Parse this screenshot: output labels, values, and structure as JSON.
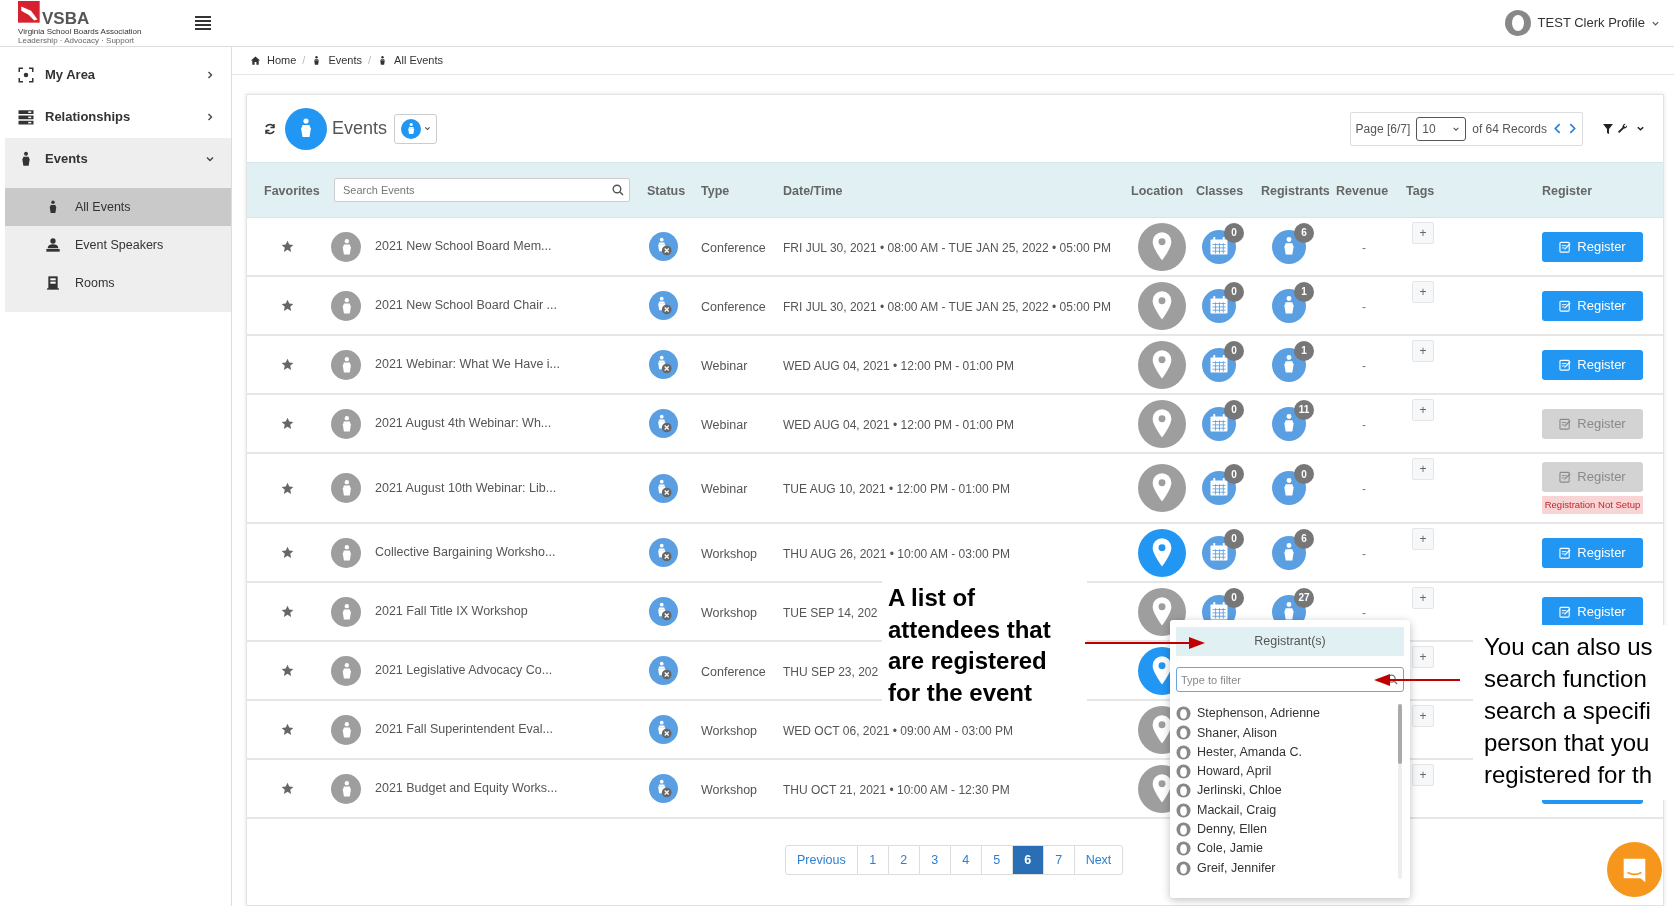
{
  "header": {
    "logo_text": "VSBA",
    "logo_subtitle": "Virginia School Boards Association",
    "logo_tagline": "Leadership · Advocacy · Support",
    "profile": "TEST Clerk Profile"
  },
  "sidebar": [
    {
      "label": "My Area",
      "expanded": false
    },
    {
      "label": "Relationships",
      "expanded": false
    },
    {
      "label": "Events",
      "expanded": true,
      "children": [
        {
          "label": "All Events",
          "selected": true
        },
        {
          "label": "Event Speakers",
          "selected": false
        },
        {
          "label": "Rooms",
          "selected": false
        }
      ]
    }
  ],
  "breadcrumb": [
    {
      "label": "Home"
    },
    {
      "separator": "/",
      "label": "Events"
    },
    {
      "separator": "/",
      "label": "All Events"
    }
  ],
  "card": {
    "title": "Events",
    "page": "Page [6/7]",
    "page_size": "10",
    "records": "of 64 Records"
  },
  "columns": [
    {
      "kind": "text",
      "label": "Favorites"
    },
    {
      "kind": "search",
      "placeholder": "Search Events"
    },
    {
      "kind": "text",
      "label": "Status"
    },
    {
      "kind": "text",
      "label": "Type"
    },
    {
      "kind": "text",
      "label": "Date/Time"
    },
    {
      "kind": "text",
      "label": "Location"
    },
    {
      "kind": "text",
      "label": "Classes"
    },
    {
      "kind": "text",
      "label": "Registrants"
    },
    {
      "kind": "text",
      "label": "Revenue"
    },
    {
      "kind": "text",
      "label": "Tags"
    },
    {
      "kind": "text",
      "label": "Register"
    }
  ],
  "rows": [
    {
      "name": "2021 New School Board Mem...",
      "type": "Conference",
      "datetime": "FRI JUL 30, 2021 • 08:00 AM - TUE JAN 25, 2022 • 05:00 PM",
      "location_set": false,
      "classes": "0",
      "registrants": "6",
      "revenue": "-",
      "tags": "+",
      "register": {
        "label": "Register",
        "disabled": false
      }
    },
    {
      "name": "2021 New School Board Chair ...",
      "type": "Conference",
      "datetime": "FRI JUL 30, 2021 • 08:00 AM - TUE JAN 25, 2022 • 05:00 PM",
      "location_set": false,
      "classes": "0",
      "registrants": "1",
      "revenue": "-",
      "tags": "+",
      "register": {
        "label": "Register",
        "disabled": false
      }
    },
    {
      "name": "2021 Webinar: What We Have i...",
      "type": "Webinar",
      "datetime": "WED AUG 04, 2021 • 12:00 PM - 01:00 PM",
      "location_set": false,
      "classes": "0",
      "registrants": "1",
      "revenue": "-",
      "tags": "+",
      "register": {
        "label": "Register",
        "disabled": false
      }
    },
    {
      "name": "2021 August 4th Webinar: Wh...",
      "type": "Webinar",
      "datetime": "WED AUG 04, 2021 • 12:00 PM - 01:00 PM",
      "location_set": false,
      "classes": "0",
      "registrants": "11",
      "revenue": "-",
      "tags": "+",
      "register": {
        "label": "Register",
        "disabled": true
      }
    },
    {
      "name": "2021 August 10th Webinar: Lib...",
      "type": "Webinar",
      "datetime": "TUE AUG 10, 2021 • 12:00 PM - 01:00 PM",
      "location_set": false,
      "classes": "0",
      "registrants": "0",
      "revenue": "-",
      "tags": "+",
      "register": {
        "label": "Register",
        "disabled": true,
        "note": "Registration Not Setup"
      }
    },
    {
      "name": "Collective Bargaining Worksho...",
      "type": "Workshop",
      "datetime": "THU AUG 26, 2021 • 10:00 AM - 03:00 PM",
      "location_set": true,
      "classes": "0",
      "registrants": "6",
      "revenue": "-",
      "tags": "+",
      "register": {
        "label": "Register",
        "disabled": false
      }
    },
    {
      "name": "2021 Fall Title IX Workshop",
      "type": "Workshop",
      "datetime": "TUE SEP 14, 202",
      "location_set": false,
      "classes": "0",
      "registrants": "27",
      "revenue": "-",
      "tags": "+",
      "register": {
        "label": "Register",
        "disabled": false
      }
    },
    {
      "name": "2021 Legislative Advocacy Co...",
      "type": "Conference",
      "datetime": "THU SEP 23, 202",
      "location_set": true,
      "tags": "+"
    },
    {
      "name": "2021 Fall Superintendent Eval...",
      "type": "Workshop",
      "datetime": "WED OCT 06, 2021 • 09:00 AM - 03:00 PM",
      "location_set": false,
      "tags": "+"
    },
    {
      "name": "2021 Budget and Equity Works...",
      "type": "Workshop",
      "datetime": "THU OCT 21, 2021 • 10:00 AM - 12:30 PM",
      "location_set": false,
      "tags": "+",
      "register": {
        "disabled": false
      }
    }
  ],
  "pagination": {
    "previous": "Previous",
    "next": "Next",
    "pages": [
      {
        "label": "1",
        "selected": false
      },
      {
        "label": "2",
        "selected": false
      },
      {
        "label": "3",
        "selected": false
      },
      {
        "label": "4",
        "selected": false
      },
      {
        "label": "5",
        "selected": false
      },
      {
        "label": "6",
        "selected": true
      },
      {
        "label": "7",
        "selected": false
      }
    ]
  },
  "popup": {
    "title": "Registrant(s)",
    "placeholder": "Type to filter",
    "names": [
      "Stephenson, Adrienne",
      "Shaner, Alison",
      "Hester, Amanda C.",
      "Howard, April",
      "Jerlinski, Chloe",
      "Mackail, Craig",
      "Denny, Ellen",
      "Cole, Jamie",
      "Greif, Jennifer"
    ]
  },
  "annotation_left": {
    "lines": [
      "A list of",
      "attendees that",
      "are registered",
      "for the event"
    ]
  },
  "annotation_right": {
    "lines": [
      "You can also us",
      "search function",
      "search a specifi",
      "person that you",
      "registered for th"
    ]
  }
}
